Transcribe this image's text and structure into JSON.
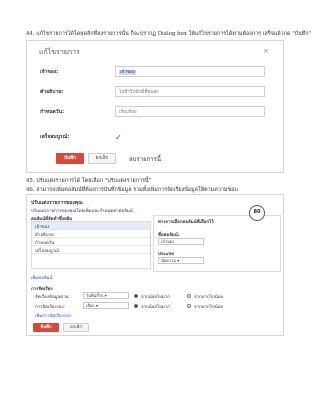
{
  "doc": {
    "step_44": "44. แก้ไขรายการได้โดยคลิกที่ลงรายการนั้น ก็จะปรากฏ Dialog box ให้แก้ไขรายการได้ตามต้องการ เสร็จแล้วกด \"บันทึก\"",
    "step_45": "45. ปรับแต่งรายการได้ โดยเลือก \"ปรับแต่งรายการนี้\"",
    "step_46": "46. สามารถเพิ่มคอลัมน์ที่ต้องการบันทึกข้อมูล รวมทั้งเพิ่มการจัดเรียงข้อมูลให้ตามความชอบ"
  },
  "edit_dialog": {
    "title": "แก้ไขรายการ",
    "close": "×",
    "fields": [
      {
        "label": "เจ้าของ:",
        "value": "เจ้าของ"
      },
      {
        "label": "คำอธิบาย:",
        "value": "ไปทำใบขับขี่ที่ขนส่ง"
      },
      {
        "label": "กำหนดวัน:",
        "value": "เรียบร้อย"
      },
      {
        "label": "เสร็จสมบูรณ์:",
        "value": "✓"
      }
    ],
    "save_label": "บันทึก",
    "cancel_label": "ยกเลิก",
    "delete_label": "ลบรายการนี้"
  },
  "customize": {
    "title": "ปรับแต่งรายการของคุณ",
    "subtitle": "ปรับแต่งรายการของคุณโดยเพิ่มและกำหนดค่าคอลัมน์",
    "left_header": "คอลัมน์ที่จัดทำซึ่งหยิบ",
    "columns": [
      "เจ้าของ",
      "คำอธิบาย",
      "กำหนดวัน",
      "เสร็จสมบูรณ์"
    ],
    "add_column": "เพิ่มคอลัมน์",
    "right_header": "ทางการเลือกคอลัมน์ที่เลือกไว้",
    "col_name_label": "ชื่อคอลัมน์:",
    "col_name_value": "เจ้าของ",
    "type_label": "ประเภท:",
    "type_value": "ข้อความ",
    "badge": "80",
    "sort_header": "การจัดเรียง",
    "sort_rows": [
      {
        "label": "จัดเรียงข้อมูลตาม:",
        "field": "วันที่แก้ไข",
        "opt_a": "จากน้อยไปมาก",
        "opt_b": "จากมากไปน้อย"
      },
      {
        "label": "การจัดเรียงรอง:",
        "field": "เลือก",
        "opt_a": "จากน้อยไปมาก",
        "opt_b": "จากมากไปน้อย"
      }
    ],
    "add_sort": "เพิ่มการจัดเรียงรอง",
    "save_label": "บันทึก",
    "cancel_label": "ยกเลิก"
  }
}
